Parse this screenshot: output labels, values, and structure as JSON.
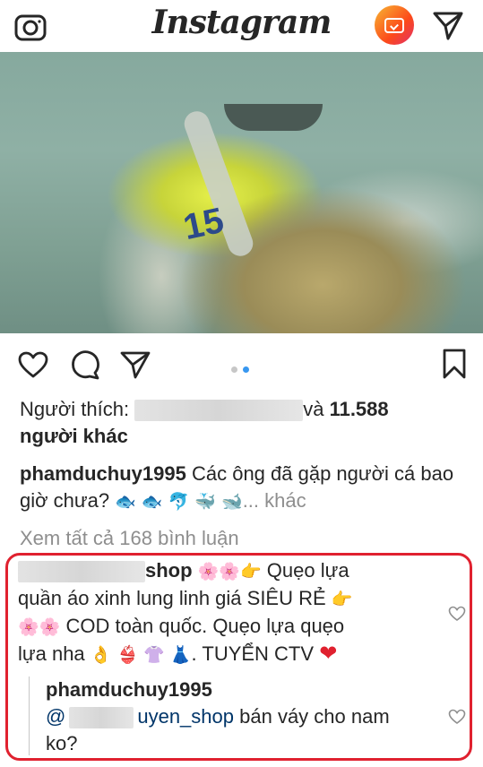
{
  "header": {
    "logo": "Instagram"
  },
  "post": {
    "likes": {
      "prefix": "Người thích: ",
      "middle": "và ",
      "count": "11.588",
      "suffix": "người khác"
    },
    "caption": {
      "username": "phamduchuy1995",
      "text": "Các ông đã gặp người cá bao giờ chưa?",
      "emojis": "🐟 🐟 🐬 🐳 🐋",
      "more": "... khác"
    },
    "view_all_comments": "Xem tất cả 168 bình luận"
  },
  "comments": [
    {
      "username_suffix": "shop",
      "line1_emoji": "🌸🌸👉",
      "line1": "Quẹo lựa",
      "line2": "quần áo xinh lung linh giá SIÊU RẺ",
      "line2_emoji": "👉",
      "line3_emoji": "🌸🌸",
      "line3": "COD toàn quốc. Quẹo lựa quẹo",
      "line4": "lựa nha",
      "line4_emoji": "👌 👙 👚 👗",
      "line4_end": ". TUYỂN CTV",
      "line4_heart": "❤"
    }
  ],
  "reply": {
    "username": "phamduchuy1995",
    "mention_at": "@",
    "mention_name": "uyen_shop",
    "text": "bán váy cho nam",
    "text2": "ko?"
  },
  "colors": {
    "highlight_border": "#e0212f",
    "dot_active": "#3897f0",
    "dot_inactive": "#c7c7c7",
    "muted": "#8e8e8e"
  }
}
